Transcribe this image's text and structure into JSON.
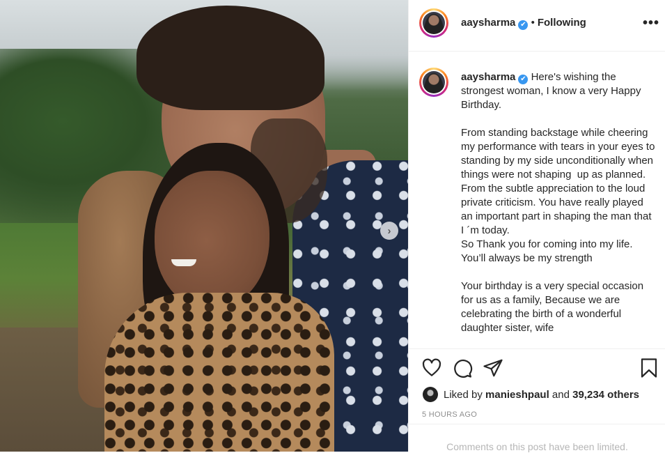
{
  "post": {
    "photo_alt_icon": "carousel-next-icon",
    "next_glyph": "›"
  },
  "header": {
    "username": "aaysharma",
    "verified_glyph": "✔",
    "separator": "•",
    "following_label": "Following",
    "more_glyph": "•••"
  },
  "caption": {
    "username": "aaysharma",
    "paragraph_1": "Here's wishing the strongest woman, I know a very Happy Birthday.",
    "paragraph_2": "From standing backstage while cheering my performance with tears in your eyes to standing by my side unconditionally when things were not shaping  up as planned. From the subtle appreciation to the loud private criticism. You have really played an important part in shaping the man that I ´m today.\nSo Thank you for coming into my life.\nYou’ll always be my strength",
    "paragraph_3": "Your birthday is a very special occasion for us as a family, Because we are celebrating the birth of a wonderful daughter sister, wife"
  },
  "actions": {
    "like_icon": "heart-icon",
    "comment_icon": "comment-icon",
    "share_icon": "share-icon",
    "save_icon": "bookmark-icon"
  },
  "likes": {
    "prefix": "Liked by",
    "user": "manieshpaul",
    "and": "and",
    "count": "39,234 others"
  },
  "timestamp": "5 HOURS AGO",
  "comments_limited": "Comments on this post have been limited."
}
